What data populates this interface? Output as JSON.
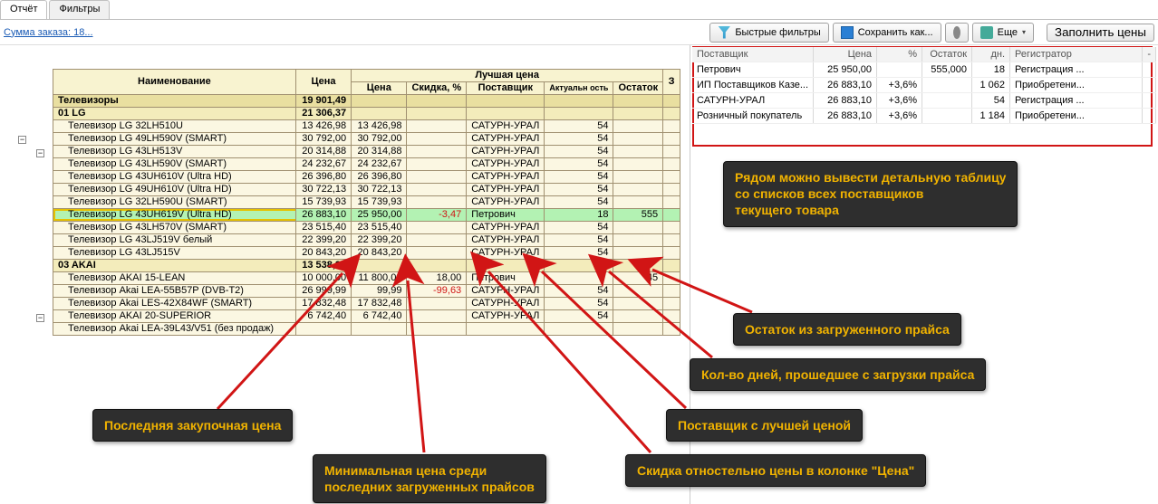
{
  "tabs": {
    "report": "Отчёт",
    "filters": "Фильтры"
  },
  "toolbar": {
    "sum_label": "Сумма заказа: 18...",
    "quick_filters": "Быстрые фильтры",
    "save_as": "Сохранить как...",
    "more": "Еще",
    "fill_prices": "Заполнить цены"
  },
  "report": {
    "headers": {
      "name": "Наименование",
      "price": "Цена",
      "best_price_group": "Лучшая цена",
      "best_price": "Цена",
      "discount": "Скидка, %",
      "supplier": "Поставщик",
      "actuality": "Актуальн ость",
      "remainder": "Остаток",
      "buy_qty": "З"
    },
    "rows": [
      {
        "lvl": 0,
        "name": "Телевизоры",
        "price": "19 901,49"
      },
      {
        "lvl": 1,
        "name": "01 LG",
        "price": "21 306,37"
      },
      {
        "lvl": 2,
        "name": "Телевизор LG 32LH510U",
        "price": "13 426,98",
        "bprice": "13 426,98",
        "supplier": "САТУРН-УРАЛ",
        "act": "54"
      },
      {
        "lvl": 2,
        "name": "Телевизор LG 49LH590V (SMART)",
        "price": "30 792,00",
        "bprice": "30 792,00",
        "supplier": "САТУРН-УРАЛ",
        "act": "54"
      },
      {
        "lvl": 2,
        "name": "Телевизор LG 43LH513V",
        "price": "20 314,88",
        "bprice": "20 314,88",
        "supplier": "САТУРН-УРАЛ",
        "act": "54"
      },
      {
        "lvl": 2,
        "name": "Телевизор LG 43LH590V (SMART)",
        "price": "24 232,67",
        "bprice": "24 232,67",
        "supplier": "САТУРН-УРАЛ",
        "act": "54"
      },
      {
        "lvl": 2,
        "name": "Телевизор LG 43UH610V (Ultra HD)",
        "price": "26 396,80",
        "bprice": "26 396,80",
        "supplier": "САТУРН-УРАЛ",
        "act": "54"
      },
      {
        "lvl": 2,
        "name": "Телевизор LG 49UH610V (Ultra HD)",
        "price": "30 722,13",
        "bprice": "30 722,13",
        "supplier": "САТУРН-УРАЛ",
        "act": "54"
      },
      {
        "lvl": 2,
        "name": "Телевизор LG 32LH590U (SMART)",
        "price": "15 739,93",
        "bprice": "15 739,93",
        "supplier": "САТУРН-УРАЛ",
        "act": "54"
      },
      {
        "lvl": 2,
        "hl": true,
        "name": "Телевизор LG 43UH619V (Ultra HD)",
        "price": "26 883,10",
        "bprice": "25 950,00",
        "disc": "-3,47",
        "supplier": "Петрович",
        "act": "18",
        "rem": "555"
      },
      {
        "lvl": 2,
        "name": "Телевизор LG 43LH570V (SMART)",
        "price": "23 515,40",
        "bprice": "23 515,40",
        "supplier": "САТУРН-УРАЛ",
        "act": "54"
      },
      {
        "lvl": 2,
        "name": "Телевизор LG 43LJ519V белый",
        "price": "22 399,20",
        "bprice": "22 399,20",
        "supplier": "САТУРН-УРАЛ",
        "act": "54"
      },
      {
        "lvl": 2,
        "name": "Телевизор LG 43LJ515V",
        "price": "20 843,20",
        "bprice": "20 843,20",
        "supplier": "САТУРН-УРАЛ",
        "act": "54"
      },
      {
        "lvl": 1,
        "name": "03 AKAI",
        "price": "13 538,22"
      },
      {
        "lvl": 2,
        "name": "Телевизор AKAI 15-LEAN",
        "price": "10 000,00",
        "bprice": "11 800,00",
        "disc_plain": "18,00",
        "supplier": "Петрович",
        "act": "",
        "rem": "45"
      },
      {
        "lvl": 2,
        "name": "Телевизор Akai LEA-55B57P (DVB-T2)",
        "price": "26 999,99",
        "bprice": "99,99",
        "disc": "-99,63",
        "supplier": "САТУРН-УРАЛ",
        "act": "54"
      },
      {
        "lvl": 2,
        "name": "Телевизор Akai LES-42X84WF (SMART)",
        "price": "17 832,48",
        "bprice": "17 832,48",
        "supplier": "САТУРН-УРАЛ",
        "act": "54"
      },
      {
        "lvl": 2,
        "name": "Телевизор AKAI 20-SUPERIOR",
        "price": "6 742,40",
        "bprice": "6 742,40",
        "supplier": "САТУРН-УРАЛ",
        "act": "54"
      },
      {
        "lvl": 2,
        "name": "Телевизор Akai LEA-39L43/V51 (без продаж)"
      }
    ]
  },
  "suppliers": {
    "headers": {
      "supplier": "Поставщик",
      "price": "Цена",
      "pct": "%",
      "remainder": "Остаток",
      "days": "дн.",
      "registrar": "Регистратор"
    },
    "rows": [
      {
        "supplier": "Петрович",
        "price": "25 950,00",
        "pct": "",
        "rem": "555,000",
        "days": "18",
        "reg": "Регистрация ..."
      },
      {
        "supplier": "ИП Поставщиков Казе...",
        "price": "26 883,10",
        "pct": "+3,6%",
        "rem": "",
        "days": "1 062",
        "reg": "Приобретени..."
      },
      {
        "supplier": "САТУРН-УРАЛ",
        "price": "26 883,10",
        "pct": "+3,6%",
        "rem": "",
        "days": "54",
        "reg": "Регистрация ..."
      },
      {
        "supplier": "Розничный покупатель",
        "price": "26 883,10",
        "pct": "+3,6%",
        "rem": "",
        "days": "1 184",
        "reg": "Приобретени..."
      }
    ]
  },
  "callouts": {
    "c_last_price": "Последняя закупочная цена",
    "c_min_price": "Минимальная цена среди\nпоследних загруженных прайсов",
    "c_discount": "Скидка отностельно цены в колонке \"Цена\"",
    "c_supplier": "Поставщик с лучшей ценой",
    "c_days": "Кол-во дней, прошедшее с загрузки прайса",
    "c_remain": "Остаток из загруженного прайса",
    "c_right_table": "Рядом можно вывести детальную таблицу\nсо списков всех поставщиков\nтекущего товара"
  },
  "glyphs": {
    "minus": "−",
    "plus": "+",
    "dropdown": "▾",
    "dash": "-"
  }
}
